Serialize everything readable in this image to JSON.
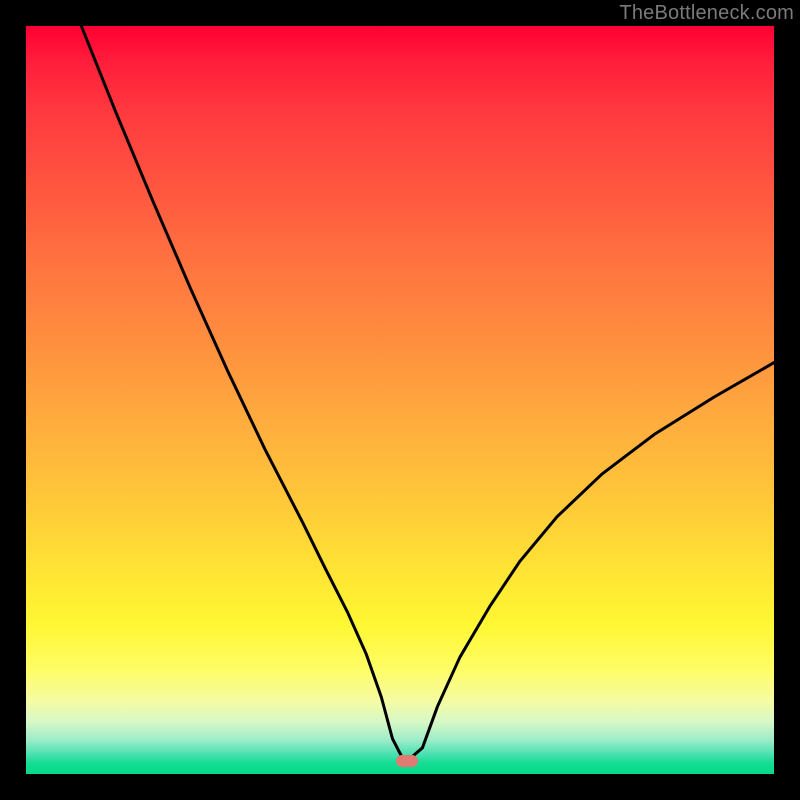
{
  "watermark": "TheBottleneck.com",
  "marker": {
    "x_frac": 0.509,
    "y_frac": 0.982
  },
  "chart_data": {
    "type": "line",
    "title": "",
    "xlabel": "",
    "ylabel": "",
    "xlim": [
      0,
      100
    ],
    "ylim": [
      0,
      100
    ],
    "grid": false,
    "series": [
      {
        "name": "bottleneck-curve",
        "x": [
          7.4,
          12.0,
          17.0,
          22.0,
          27.0,
          32.0,
          37.0,
          40.0,
          43.0,
          45.5,
          47.5,
          49.0,
          50.3,
          51.5,
          53.0,
          55.0,
          58.0,
          62.0,
          66.0,
          71.0,
          77.0,
          84.0,
          92.0,
          100.0
        ],
        "y": [
          100.0,
          88.5,
          76.5,
          64.9,
          53.8,
          43.3,
          33.6,
          27.5,
          21.6,
          16.0,
          10.3,
          4.7,
          2.2,
          2.2,
          3.5,
          9.0,
          15.6,
          22.4,
          28.4,
          34.4,
          40.1,
          45.4,
          50.4,
          55.0
        ]
      }
    ],
    "marker_point": {
      "x": 50.9,
      "y": 1.8
    }
  }
}
